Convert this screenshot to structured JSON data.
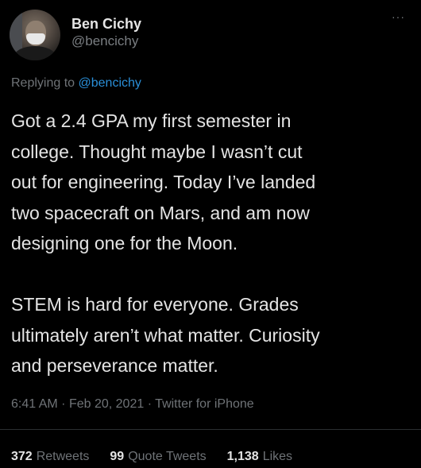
{
  "tweet": {
    "author": {
      "name": "Ben Cichy",
      "handle": "@bencichy"
    },
    "more_label": "···",
    "reply": {
      "prefix": "Replying to",
      "mention": "@bencichy"
    },
    "paragraphs": [
      "Got a 2.4 GPA my first semester in\ncollege. Thought maybe I wasn’t cut\nout for engineering. Today I’ve landed\ntwo spacecraft on Mars, and am now\ndesigning one for the Moon.",
      "STEM is hard for everyone. Grades\nultimately aren’t what matter.  Curiosity\nand perseverance matter."
    ],
    "meta": {
      "time": "6:41 AM",
      "date": "Feb 20, 2021",
      "source": "Twitter for iPhone",
      "separator": "·"
    },
    "stats": {
      "retweets": {
        "count": "372",
        "label": "Retweets"
      },
      "quotes": {
        "count": "99",
        "label": "Quote Tweets"
      },
      "likes": {
        "count": "1,138",
        "label": "Likes"
      }
    }
  },
  "colors": {
    "background": "#000000",
    "text": "#e4e4e4",
    "muted": "#6f7377",
    "link": "#2a8fd8"
  }
}
